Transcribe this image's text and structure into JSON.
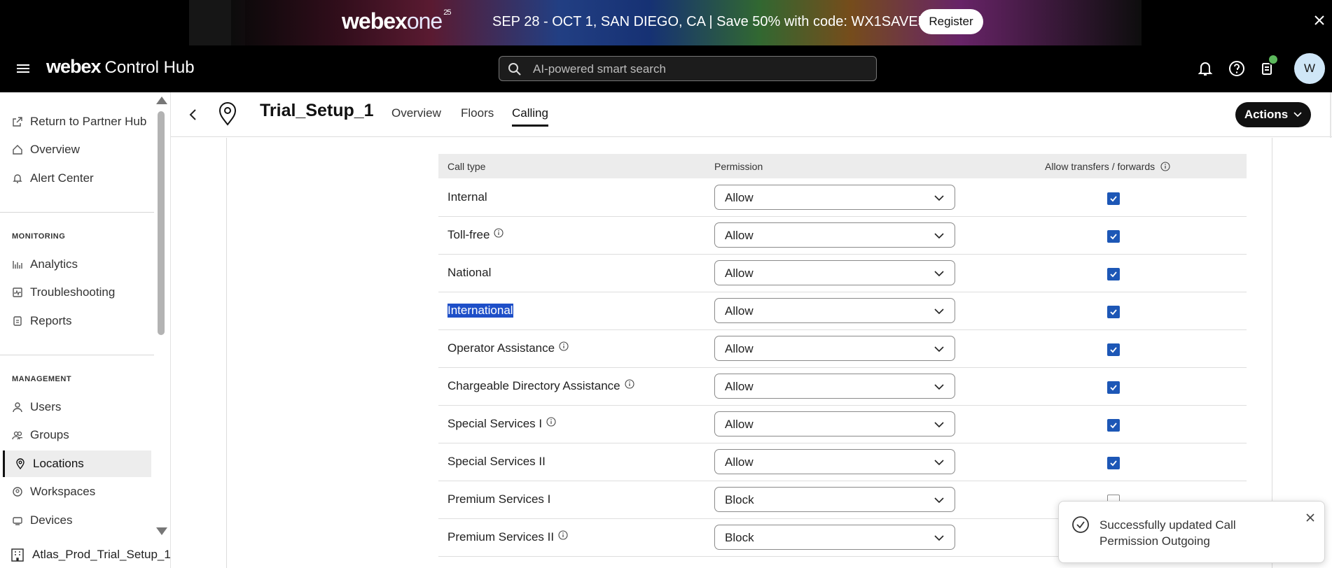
{
  "banner": {
    "brand": "webex",
    "brand_one": "one",
    "brand_sup": "25",
    "text": "SEP 28 - OCT 1, SAN DIEGO, CA | Save 50% with code: WX1SAVE50",
    "register_label": "Register"
  },
  "header": {
    "logo_bold": "webex",
    "logo_product": "Control Hub",
    "search_placeholder": "AI-powered smart search",
    "avatar_initial": "W"
  },
  "sidebar": {
    "top_items": [
      {
        "label": "Return to Partner Hub",
        "icon": "external-link-icon"
      },
      {
        "label": "Overview",
        "icon": "home-icon"
      },
      {
        "label": "Alert Center",
        "icon": "bell-icon"
      }
    ],
    "monitoring_header": "MONITORING",
    "monitoring_items": [
      {
        "label": "Analytics",
        "icon": "bar-chart-icon"
      },
      {
        "label": "Troubleshooting",
        "icon": "pulse-icon"
      },
      {
        "label": "Reports",
        "icon": "report-icon"
      }
    ],
    "management_header": "MANAGEMENT",
    "management_items": [
      {
        "label": "Users",
        "icon": "user-icon"
      },
      {
        "label": "Groups",
        "icon": "group-icon"
      },
      {
        "label": "Locations",
        "icon": "location-pin-icon",
        "active": true
      },
      {
        "label": "Workspaces",
        "icon": "workspace-icon"
      },
      {
        "label": "Devices",
        "icon": "device-icon"
      }
    ],
    "org_name": "Atlas_Prod_Trial_Setup_1"
  },
  "page": {
    "title": "Trial_Setup_1",
    "tabs": [
      "Overview",
      "Floors",
      "Calling"
    ],
    "active_tab": "Calling",
    "actions_label": "Actions"
  },
  "table": {
    "headers": {
      "call_type": "Call type",
      "permission": "Permission",
      "transfers": "Allow transfers / forwards"
    },
    "rows": [
      {
        "call_type": "Internal",
        "permission": "Allow",
        "transfer": true,
        "info": false
      },
      {
        "call_type": "Toll-free",
        "permission": "Allow",
        "transfer": true,
        "info": true
      },
      {
        "call_type": "National",
        "permission": "Allow",
        "transfer": true,
        "info": false
      },
      {
        "call_type": "International",
        "permission": "Allow",
        "transfer": true,
        "info": false,
        "selected_text": true
      },
      {
        "call_type": "Operator Assistance",
        "permission": "Allow",
        "transfer": true,
        "info": true
      },
      {
        "call_type": "Chargeable Directory Assistance",
        "permission": "Allow",
        "transfer": true,
        "info": true
      },
      {
        "call_type": "Special Services I",
        "permission": "Allow",
        "transfer": true,
        "info": true
      },
      {
        "call_type": "Special Services II",
        "permission": "Allow",
        "transfer": true,
        "info": false
      },
      {
        "call_type": "Premium Services I",
        "permission": "Block",
        "transfer": false,
        "info": false
      },
      {
        "call_type": "Premium Services II",
        "permission": "Block",
        "transfer": false,
        "info": true
      }
    ]
  },
  "toast": {
    "message": "Successfully updated Call Permission Outgoing"
  },
  "colors": {
    "accent": "#1d57b6",
    "header_bg": "#000000",
    "selection": "#1e4fc8"
  }
}
